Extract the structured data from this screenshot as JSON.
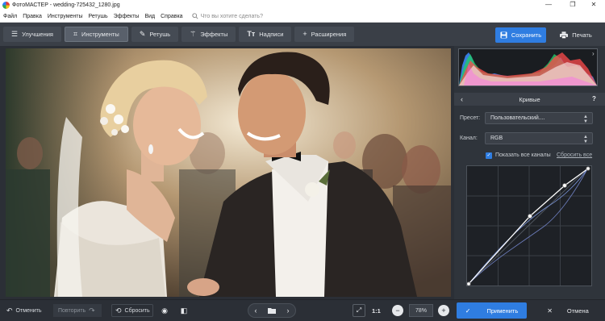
{
  "window": {
    "title": "ФотоМАСТЕР - wedding-725432_1280.jpg",
    "controls": [
      "—",
      "❐",
      "✕"
    ]
  },
  "menu": {
    "items": [
      "Файл",
      "Правка",
      "Инструменты",
      "Ретушь",
      "Эффекты",
      "Вид",
      "Справка"
    ],
    "search_placeholder": "Что вы хотите сделать?"
  },
  "toolbar": {
    "tabs": [
      {
        "label": "Улучшения",
        "icon": "sliders-icon",
        "active": false
      },
      {
        "label": "Инструменты",
        "icon": "crop-icon",
        "active": true
      },
      {
        "label": "Ретушь",
        "icon": "brush-icon",
        "active": false
      },
      {
        "label": "Эффекты",
        "icon": "wand-icon",
        "active": false
      },
      {
        "label": "Надписи",
        "icon": "text-icon",
        "active": false
      },
      {
        "label": "Расширения",
        "icon": "plus-icon",
        "active": false
      }
    ],
    "save_label": "Сохранить",
    "print_label": "Печать"
  },
  "panel": {
    "title": "Кривые",
    "preset_label": "Пресет:",
    "preset_value": "Пользовательский....",
    "channel_label": "Канал:",
    "channel_value": "RGB",
    "show_all_label": "Показать все каналы",
    "show_all_checked": true,
    "reset_all_label": "Сбросить все"
  },
  "bottom": {
    "undo_label": "Отменить",
    "redo_label": "Повторить",
    "reset_label": "Сбросить",
    "scale_label": "1:1",
    "zoom_value": "78%",
    "apply_label": "Применить",
    "cancel_label": "Отмена"
  },
  "colors": {
    "accent": "#2f7de1",
    "toolbar": "#3a3f47",
    "background": "#2b2f36"
  }
}
